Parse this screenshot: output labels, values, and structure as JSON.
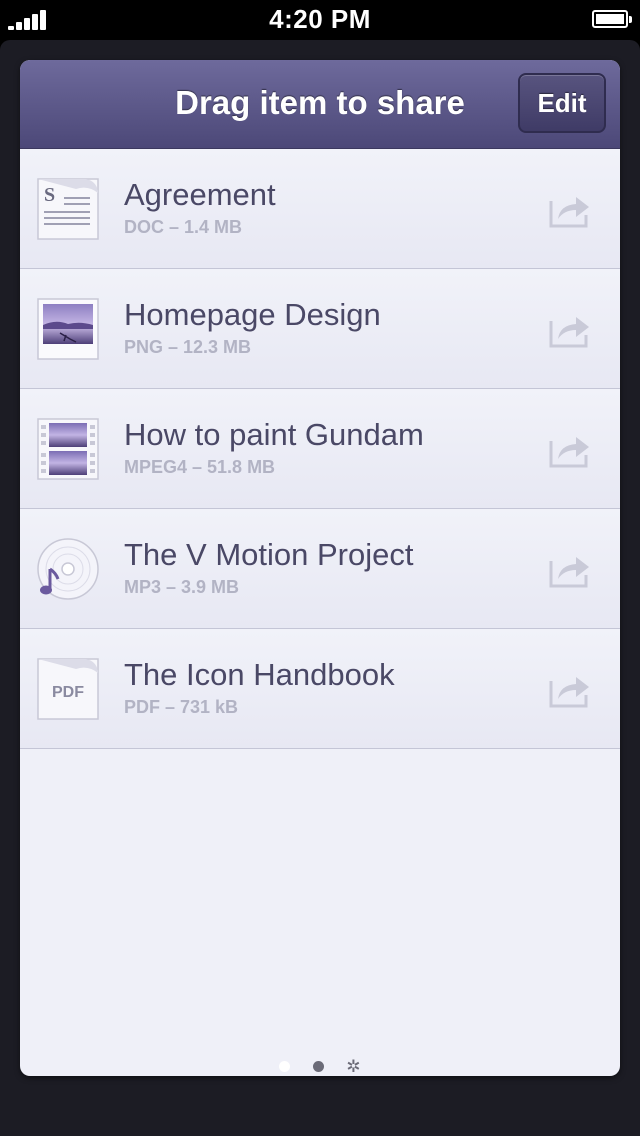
{
  "status_bar": {
    "time": "4:20 PM"
  },
  "nav": {
    "title": "Drag item to share",
    "edit_label": "Edit"
  },
  "files": [
    {
      "title": "Agreement",
      "meta": "DOC – 1.4 MB",
      "icon": "document-icon"
    },
    {
      "title": "Homepage Design",
      "meta": "PNG – 12.3 MB",
      "icon": "image-icon"
    },
    {
      "title": "How to paint Gundam",
      "meta": "MPEG4 – 51.8 MB",
      "icon": "video-icon"
    },
    {
      "title": "The V Motion Project",
      "meta": "MP3 – 3.9 MB",
      "icon": "music-icon"
    },
    {
      "title": "The Icon Handbook",
      "meta": "PDF – 731 kB",
      "icon": "pdf-icon"
    }
  ],
  "icon_text": {
    "doc_letter": "S",
    "pdf_label": "PDF"
  },
  "pager": {
    "pages": 3,
    "current": 1
  },
  "colors": {
    "nav_top": "#6e6a9c",
    "nav_bottom": "#4c4878",
    "title_text": "#4a4866",
    "meta_text": "#b2b3c4",
    "accent_purple": "#6b5a9e"
  }
}
